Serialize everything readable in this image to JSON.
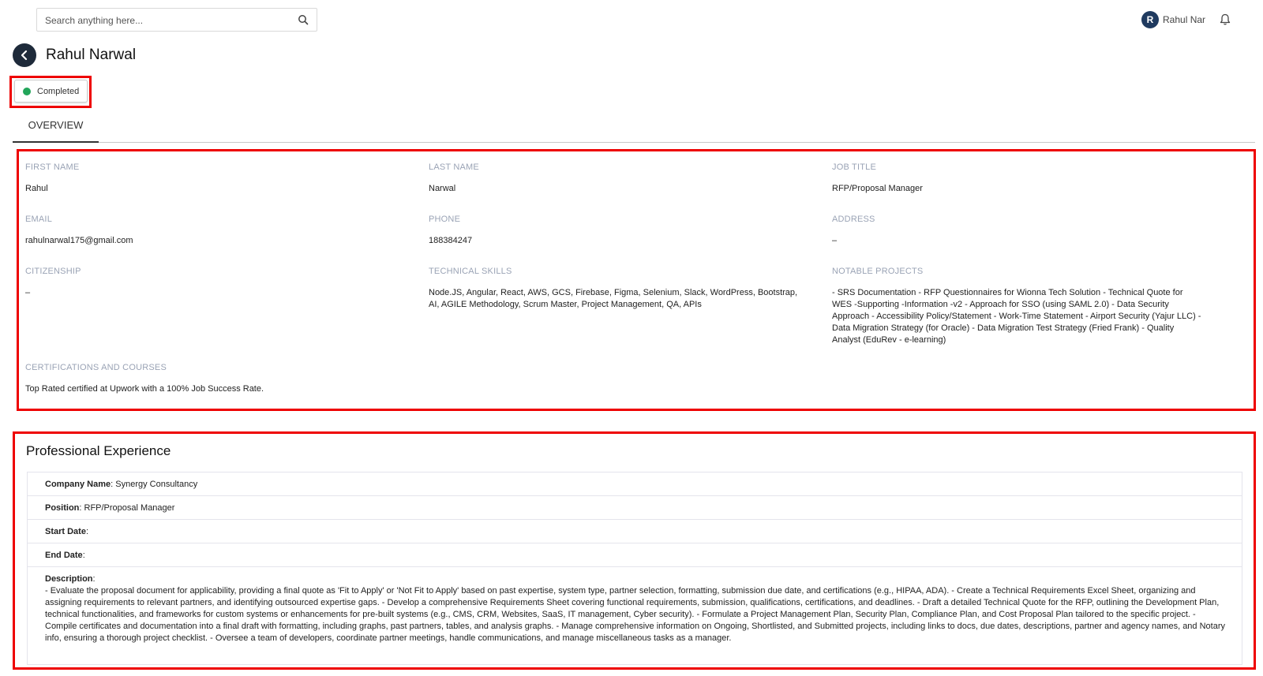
{
  "search": {
    "placeholder": "Search anything here..."
  },
  "user": {
    "initial": "R",
    "name": "Rahul Nar"
  },
  "page": {
    "title": "Rahul Narwal"
  },
  "status": {
    "label": "Completed",
    "color": "#22a55a"
  },
  "tabs": [
    {
      "label": "OVERVIEW",
      "active": true
    }
  ],
  "overview": {
    "first_name": {
      "label": "FIRST NAME",
      "value": "Rahul"
    },
    "last_name": {
      "label": "LAST NAME",
      "value": "Narwal"
    },
    "job_title": {
      "label": "JOB TITLE",
      "value": "RFP/Proposal Manager"
    },
    "email": {
      "label": "EMAIL",
      "value": "rahulnarwal175@gmail.com"
    },
    "phone": {
      "label": "PHONE",
      "value": "188384247"
    },
    "address": {
      "label": "ADDRESS",
      "value": "–"
    },
    "citizenship": {
      "label": "CITIZENSHIP",
      "value": "–"
    },
    "technical_skills": {
      "label": "TECHNICAL SKILLS",
      "value": "Node.JS, Angular, React, AWS, GCS, Firebase, Figma, Selenium, Slack, WordPress, Bootstrap, AI, AGILE Methodology, Scrum Master, Project Management, QA, APIs"
    },
    "notable_projects": {
      "label": "NOTABLE PROJECTS",
      "value": "- SRS Documentation - RFP Questionnaires for Wionna Tech Solution - Technical Quote for WES -Supporting -Information -v2 - Approach for SSO (using SAML 2.0) - Data Security Approach - Accessibility Policy/Statement - Work-Time Statement - Airport Security (Yajur LLC) - Data Migration Strategy (for Oracle) - Data Migration Test Strategy (Fried Frank) - Quality Analyst (EduRev - e-learning)"
    },
    "certifications": {
      "label": "CERTIFICATIONS AND COURSES",
      "value": "Top Rated certified at Upwork with a 100% Job Success Rate."
    }
  },
  "experience": {
    "title": "Professional Experience",
    "company_label": "Company Name",
    "company_value": ": Synergy Consultancy",
    "position_label": "Position",
    "position_value": ": RFP/Proposal Manager",
    "start_label": "Start Date",
    "start_value": ":",
    "end_label": "End Date",
    "end_value": ":",
    "desc_label": "Description",
    "desc_colon": ":",
    "description": "- Evaluate the proposal document for applicability, providing a final quote as 'Fit to Apply' or 'Not Fit to Apply' based on past expertise, system type, partner selection, formatting, submission due date, and certifications (e.g., HIPAA, ADA). - Create a Technical Requirements Excel Sheet, organizing and assigning requirements to relevant partners, and identifying outsourced expertise gaps. - Develop a comprehensive Requirements Sheet covering functional requirements, submission, qualifications, certifications, and deadlines. - Draft a detailed Technical Quote for the RFP, outlining the Development Plan, technical functionalities, and frameworks for custom systems or enhancements for pre-built systems (e.g., CMS, CRM, Websites, SaaS, IT management, Cyber security). - Formulate a Project Management Plan, Security Plan, Compliance Plan, and Cost Proposal Plan tailored to the specific project. - Compile certificates and documentation into a final draft with formatting, including graphs, past partners, tables, and analysis graphs. - Manage comprehensive information on Ongoing, Shortlisted, and Submitted projects, including links to docs, due dates, descriptions, partner and agency names, and Notary info, ensuring a thorough project checklist. - Oversee a team of developers, coordinate partner meetings, handle communications, and manage miscellaneous tasks as a manager."
  }
}
